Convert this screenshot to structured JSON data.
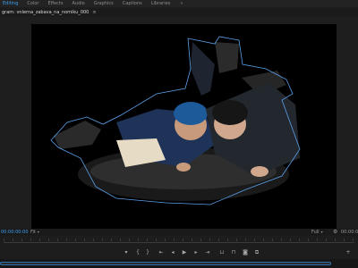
{
  "workspace": {
    "tabs": [
      {
        "label": "Editing",
        "active": true
      },
      {
        "label": "Color",
        "active": false
      },
      {
        "label": "Effects",
        "active": false
      },
      {
        "label": "Audio",
        "active": false
      },
      {
        "label": "Graphics",
        "active": false
      },
      {
        "label": "Captions",
        "active": false
      },
      {
        "label": "Libraries",
        "active": false
      }
    ],
    "more_label": "»"
  },
  "panel": {
    "tab_label": "gram: vnlerna_zabava_na_nomiku_000",
    "close_label": "≡"
  },
  "monitor": {
    "timecode": "00:00:00:00",
    "fit_label": "Fit",
    "quality_label": "Full",
    "timecode_right": "00:00:0"
  },
  "transport": {
    "buttons": [
      {
        "name": "add-marker-button",
        "glyph": "▾"
      },
      {
        "name": "mark-in-button",
        "glyph": "{"
      },
      {
        "name": "mark-out-button",
        "glyph": "}"
      },
      {
        "name": "go-to-in-button",
        "glyph": "⇤"
      },
      {
        "name": "step-back-button",
        "glyph": "◂"
      },
      {
        "name": "play-button",
        "glyph": "▶"
      },
      {
        "name": "step-forward-button",
        "glyph": "▸"
      },
      {
        "name": "go-to-out-button",
        "glyph": "⇥"
      },
      {
        "name": "lift-button",
        "glyph": "⊔"
      },
      {
        "name": "extract-button",
        "glyph": "⊓"
      },
      {
        "name": "export-frame-button",
        "glyph": "◙"
      },
      {
        "name": "comparison-view-button",
        "glyph": "⧉"
      },
      {
        "name": "settings-button",
        "glyph": "+"
      }
    ]
  },
  "colors": {
    "accent": "#3d9ff0",
    "mask_path": "#5aa0e8"
  }
}
